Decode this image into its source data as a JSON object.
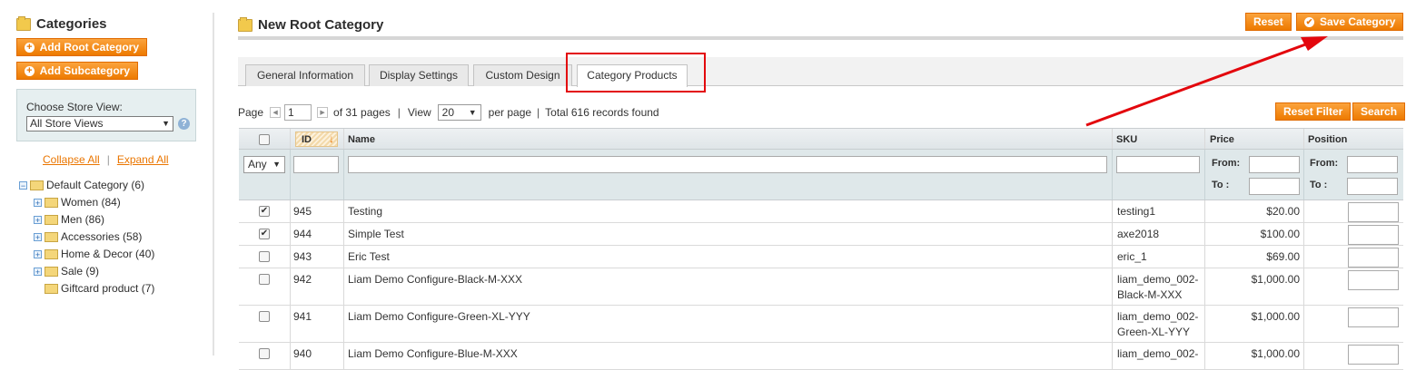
{
  "sidebar": {
    "title": "Categories",
    "add_root_label": "Add Root Category",
    "add_sub_label": "Add Subcategory",
    "store_view_label": "Choose Store View:",
    "store_view_value": "All Store Views",
    "collapse_all": "Collapse All",
    "expand_all": "Expand All",
    "separator": "|",
    "tree": {
      "root": "Default Category (6)",
      "children": [
        "Women (84)",
        "Men (86)",
        "Accessories (58)",
        "Home & Decor (40)",
        "Sale (9)",
        "Giftcard product (7)"
      ]
    }
  },
  "header": {
    "title": "New Root Category",
    "reset_label": "Reset",
    "save_label": "Save Category"
  },
  "tabs": [
    {
      "label": "General Information",
      "active": false
    },
    {
      "label": "Display Settings",
      "active": false
    },
    {
      "label": "Custom Design",
      "active": false
    },
    {
      "label": "Category Products",
      "active": true
    }
  ],
  "pager": {
    "page_label": "Page",
    "page_value": "1",
    "of_pages": "of 31 pages",
    "sep": "|",
    "view_label": "View",
    "per_page_value": "20",
    "per_page_label": "per page",
    "total": "Total 616 records found",
    "reset_filter_label": "Reset Filter",
    "search_label": "Search"
  },
  "grid": {
    "columns": {
      "id": "ID",
      "name": "Name",
      "sku": "SKU",
      "price": "Price",
      "position": "Position"
    },
    "filters": {
      "any_value": "Any",
      "from_label": "From:",
      "to_label": "To :"
    },
    "rows": [
      {
        "checked": true,
        "id": "945",
        "name": "Testing",
        "sku": "testing1",
        "price": "$20.00"
      },
      {
        "checked": true,
        "id": "944",
        "name": "Simple Test",
        "sku": "axe2018",
        "price": "$100.00"
      },
      {
        "checked": false,
        "id": "943",
        "name": "Eric Test",
        "sku": "eric_1",
        "price": "$69.00"
      },
      {
        "checked": false,
        "id": "942",
        "name": "Liam Demo Configure-Black-M-XXX",
        "sku": "liam_demo_002-Black-M-XXX",
        "sku_line1": "liam_demo_002-",
        "sku_line2": "Black-M-XXX",
        "price": "$1,000.00"
      },
      {
        "checked": false,
        "id": "941",
        "name": "Liam Demo Configure-Green-XL-YYY",
        "sku": "liam_demo_002-Green-XL-YYY",
        "sku_line1": "liam_demo_002-",
        "sku_line2": "Green-XL-YYY",
        "price": "$1,000.00"
      },
      {
        "checked": false,
        "id": "940",
        "name": "Liam Demo Configure-Blue-M-XXX",
        "sku_line1": "liam_demo_002-",
        "price": "$1,000.00"
      }
    ]
  },
  "annotation": {
    "highlight_color": "#e3070d",
    "accent_color": "#f18200"
  }
}
